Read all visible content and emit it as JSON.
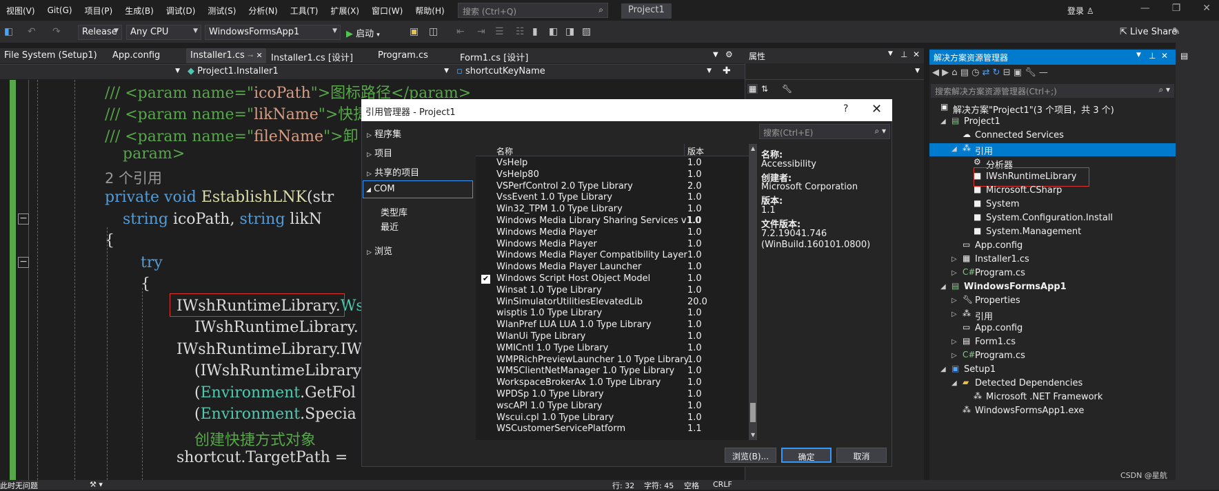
{
  "menu": [
    "视图(V)",
    "Git(G)",
    "项目(P)",
    "生成(B)",
    "调试(D)",
    "测试(S)",
    "分析(N)",
    "工具(T)",
    "扩展(X)",
    "窗口(W)",
    "帮助(H)"
  ],
  "search_placeholder": "搜索 (Ctrl+Q)",
  "project_name": "Project1",
  "login": "登录",
  "toolbar": {
    "config": "Release",
    "platform": "Any CPU",
    "startup_project": "WindowsFormsApp1",
    "start_label": "启动",
    "live_share": "Live Share"
  },
  "tabs": [
    "File System (Setup1)",
    "App.config",
    "Installer1.cs",
    "Installer1.cs [设计]",
    "Program.cs",
    "Form1.cs [设计]"
  ],
  "nav": {
    "class": "Project1.Installer1",
    "member": "shortcutKeyName"
  },
  "code": {
    "l1a": "/// <param name=\"",
    "l1b": "icoPath",
    "l1c": "\">图标路径</param>",
    "l2a": "/// <param name=\"",
    "l2b": "likName",
    "l2c": "\">快捷",
    "l3a": "/// <param name=\"",
    "l3b": "fileName",
    "l3c": "\">卸",
    "l4": "param>",
    "refs": "2 个引用",
    "l5a": "private void ",
    "l5b": "EstablishLNK",
    "l5c": "(str",
    "l6a": "string ",
    "l6b": "icoPath, ",
    "l6c": "string ",
    "l6d": "likN",
    "l7": "{",
    "l8": "try",
    "l9": "{",
    "l10a": "IWshRuntimeLibrary.",
    "l10b": "Ws",
    "l11": "IWshRuntimeLibrary.",
    "l12": "IWshRuntimeLibrary.IW",
    "l13": "(IWshRuntimeLibrary",
    "l14a": "(",
    "l14b": "Environment",
    "l14c": ".GetFol",
    "l15a": "(",
    "l15b": "Environment",
    "l15c": ".Specia",
    "l16": "创建快捷方式对象",
    "l17": "shortcut.TargetPath ="
  },
  "status": {
    "left": "此时无问题",
    "line": "行: 32",
    "col": "字符: 45",
    "space": "空格",
    "eol": "CRLF"
  },
  "properties_title": "属性",
  "solution": {
    "title": "解决方案资源管理器",
    "search_placeholder": "搜索解决方案资源管理器(Ctrl+;)",
    "items": [
      {
        "label": "解决方案\"Project1\"(3 个项目，共 3 个)"
      },
      {
        "label": "Project1"
      },
      {
        "label": "Connected Services"
      },
      {
        "label": "引用"
      },
      {
        "label": "分析器"
      },
      {
        "label": "IWshRuntimeLibrary"
      },
      {
        "label": "Microsoft.CSharp"
      },
      {
        "label": "System"
      },
      {
        "label": "System.Configuration.Install"
      },
      {
        "label": "System.Management"
      },
      {
        "label": "App.config"
      },
      {
        "label": "Installer1.cs"
      },
      {
        "label": "Program.cs"
      },
      {
        "label": "WindowsFormsApp1"
      },
      {
        "label": "Properties"
      },
      {
        "label": "引用"
      },
      {
        "label": "App.config"
      },
      {
        "label": "Form1.cs"
      },
      {
        "label": "Program.cs"
      },
      {
        "label": "Setup1"
      },
      {
        "label": "Detected Dependencies"
      },
      {
        "label": "Microsoft .NET Framework"
      },
      {
        "label": "WindowsFormsApp1.exe"
      }
    ]
  },
  "dialog": {
    "title": "引用管理器 - Project1",
    "help": "?",
    "nav": [
      "程序集",
      "项目",
      "共享的项目",
      "COM",
      "类型库",
      "最近",
      "浏览"
    ],
    "search_placeholder": "搜索(Ctrl+E)",
    "col_name": "名称",
    "col_version": "版本",
    "rows": [
      {
        "name": "VsHelp",
        "version": "1.0",
        "checked": false
      },
      {
        "name": "VsHelp80",
        "version": "1.0",
        "checked": false
      },
      {
        "name": "VSPerfControl 2.0 Type Library",
        "version": "2.0",
        "checked": false
      },
      {
        "name": "VssEvent 1.0 Type Library",
        "version": "1.0",
        "checked": false
      },
      {
        "name": "Win32_TPM 1.0 Type Library",
        "version": "1.0",
        "checked": false
      },
      {
        "name": "Windows Media Library Sharing Services v1.0",
        "version": "1.0",
        "checked": false
      },
      {
        "name": "Windows Media Player",
        "version": "1.0",
        "checked": false
      },
      {
        "name": "Windows Media Player",
        "version": "1.0",
        "checked": false
      },
      {
        "name": "Windows Media Player Compatibility Layer",
        "version": "1.0",
        "checked": false
      },
      {
        "name": "Windows Media Player Launcher",
        "version": "1.0",
        "checked": false
      },
      {
        "name": "Windows Script Host Object Model",
        "version": "1.0",
        "checked": true
      },
      {
        "name": "Winsat 1.0 Type Library",
        "version": "1.0",
        "checked": false
      },
      {
        "name": "WinSimulatorUtilitiesElevatedLib",
        "version": "20.0",
        "checked": false
      },
      {
        "name": "wisptis 1.0 Type Library",
        "version": "1.0",
        "checked": false
      },
      {
        "name": "WlanPref LUA LUA 1.0 Type Library",
        "version": "1.0",
        "checked": false
      },
      {
        "name": "WlanUi Type Library",
        "version": "1.0",
        "checked": false
      },
      {
        "name": "WMICntl 1.0 Type Library",
        "version": "1.0",
        "checked": false
      },
      {
        "name": "WMPRichPreviewLauncher 1.0 Type Library",
        "version": "1.0",
        "checked": false
      },
      {
        "name": "WMSClientNetManager 1.0 Type Library",
        "version": "1.0",
        "checked": false
      },
      {
        "name": "WorkspaceBrokerAx 1.0 Type Library",
        "version": "1.0",
        "checked": false
      },
      {
        "name": "WPDSp 1.0 Type Library",
        "version": "1.0",
        "checked": false
      },
      {
        "name": "wscAPI 1.0 Type Library",
        "version": "1.0",
        "checked": false
      },
      {
        "name": "Wscui.cpl 1.0 Type Library",
        "version": "1.0",
        "checked": false
      },
      {
        "name": "WSCustomerServicePlatform",
        "version": "1.1",
        "checked": false
      }
    ],
    "detail": {
      "name_label": "名称:",
      "name": "Accessibility",
      "creator_label": "创建者:",
      "creator": "Microsoft Corporation",
      "version_label": "版本:",
      "version": "1.1",
      "file_version_label": "文件版本:",
      "file_version": "7.2.19041.746",
      "file_version2": "(WinBuild.160101.0800)"
    },
    "btn_browse": "浏览(B)...",
    "btn_ok": "确定",
    "btn_cancel": "取消"
  },
  "watermark": "CSDN @星航"
}
